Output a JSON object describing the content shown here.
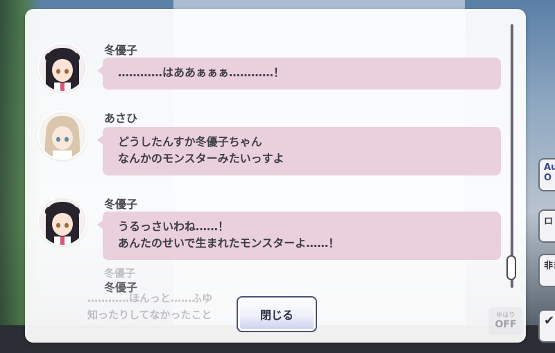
{
  "log": {
    "entries": [
      {
        "speaker": "冬優子",
        "lines": [
          "…………はああぁぁぁ…………！"
        ]
      },
      {
        "speaker": "あさひ",
        "lines": [
          "どうしたんすか冬優子ちゃん",
          "なんかのモンスターみたいっすよ"
        ]
      },
      {
        "speaker": "冬優子",
        "lines": [
          "うるっさいわね……！",
          "あんたのせいで生まれたモンスターよ……！"
        ]
      }
    ],
    "partial": {
      "speaker_1": "冬優子",
      "speaker_2": "冬優子"
    },
    "close_label": "閉じる"
  },
  "background": {
    "underlying_line_1": "…………ほんっと……ふゆ",
    "underlying_line_2": "知ったりしてなかったこと",
    "side_auto": "Au",
    "side_auto_sub": "O",
    "side_log": "ロ",
    "side_hide": "非ま",
    "check_mark": "✔",
    "auto_toggle_small": "ゆはり",
    "auto_toggle_big": "OFF"
  },
  "colors": {
    "bubble": "#eacfdc",
    "panel": "#ffffff",
    "button_border": "#4c5272"
  }
}
